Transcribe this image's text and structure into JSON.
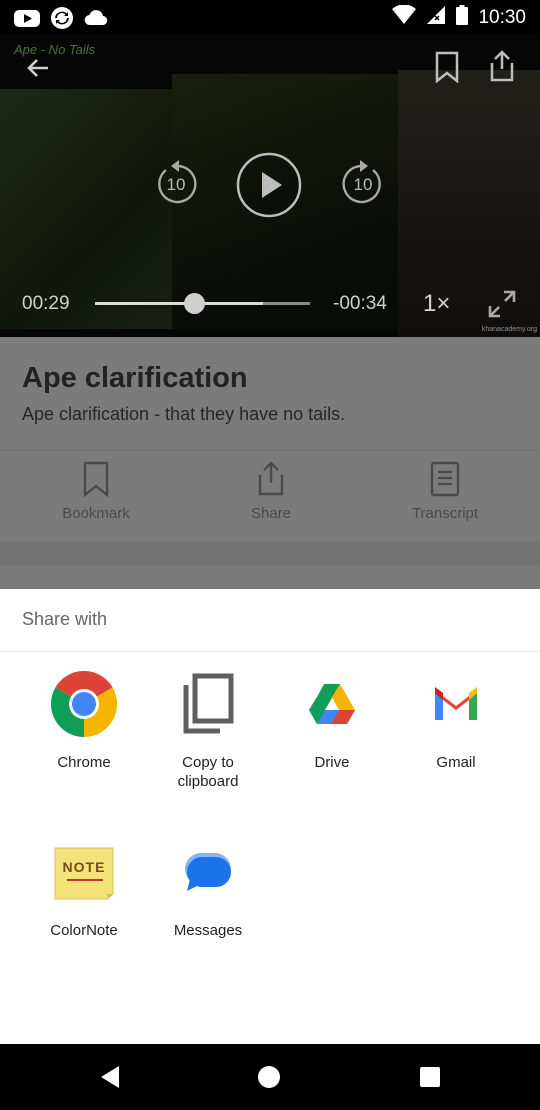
{
  "status_bar": {
    "time": "10:30",
    "icons": [
      "youtube-icon",
      "sync-icon",
      "cloud-icon",
      "wifi-icon",
      "signal-icon",
      "battery-icon"
    ]
  },
  "video": {
    "overlay_title": "Ape - No Tails",
    "elapsed": "00:29",
    "remaining": "-00:34",
    "speed": "1×",
    "rewind_seconds": "10",
    "forward_seconds": "10",
    "progress": 0.46,
    "buffered": 0.78,
    "watermark": "khanacademy.org"
  },
  "lesson": {
    "title": "Ape clarification",
    "description": "Ape clarification - that they have no tails.",
    "actions": {
      "bookmark": "Bookmark",
      "share": "Share",
      "transcript": "Transcript"
    }
  },
  "share_sheet": {
    "header": "Share with",
    "apps": {
      "chrome": "Chrome",
      "clipboard": "Copy to\nclipboard",
      "drive": "Drive",
      "gmail": "Gmail",
      "colornote": "ColorNote",
      "messages": "Messages"
    },
    "note_icon_text": "NOTE"
  },
  "colors": {
    "chrome_red": "#DB4437",
    "chrome_yellow": "#F4B400",
    "chrome_green": "#0F9D58",
    "chrome_blue": "#4285F4",
    "messages_blue": "#1A73E8"
  }
}
